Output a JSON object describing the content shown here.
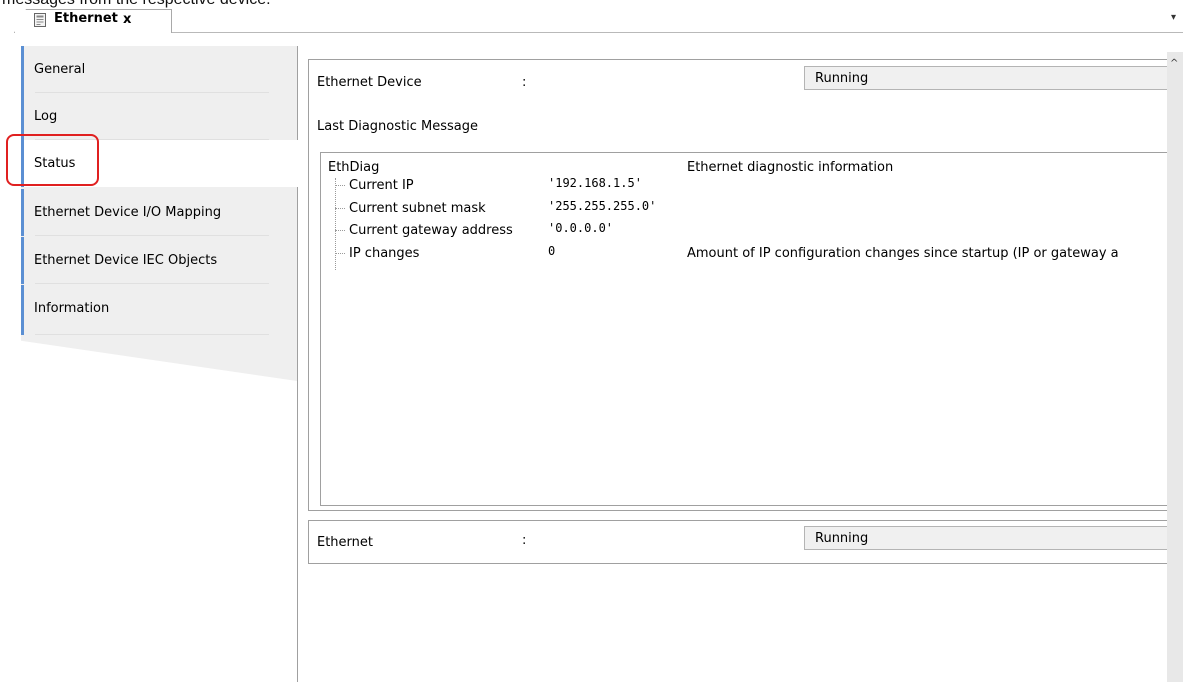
{
  "caption": "messages from the respective device.",
  "editor_tab": {
    "title": "Ethernet",
    "close_glyph": "x",
    "icon": "device-document-icon",
    "menu_glyph": "▾"
  },
  "nav": {
    "items": [
      {
        "label": "General"
      },
      {
        "label": "Log"
      },
      {
        "label": "Status"
      },
      {
        "label": "Ethernet Device I/O Mapping"
      },
      {
        "label": "Ethernet Device IEC Objects"
      },
      {
        "label": "Information"
      }
    ],
    "active": "Status",
    "accent": "#5b8fd3",
    "highlight_color": "#e02020"
  },
  "status_panel": {
    "device_label": "Ethernet Device",
    "separator": ":",
    "device_status": "Running",
    "last_diag_label": "Last Diagnostic Message",
    "diag": {
      "root_name": "EthDiag",
      "root_desc": "Ethernet diagnostic information",
      "rows": [
        {
          "name": "Current IP",
          "value": "'192.168.1.5'",
          "desc": ""
        },
        {
          "name": "Current subnet mask",
          "value": "'255.255.255.0'",
          "desc": ""
        },
        {
          "name": "Current gateway address",
          "value": "'0.0.0.0'",
          "desc": ""
        },
        {
          "name": "IP changes",
          "value": "0",
          "desc": "Amount of IP configuration changes since startup (IP or gateway a"
        }
      ]
    }
  },
  "ethernet_panel": {
    "label": "Ethernet",
    "separator": ":",
    "status": "Running"
  },
  "scrollbar": {
    "up_glyph": "^"
  }
}
